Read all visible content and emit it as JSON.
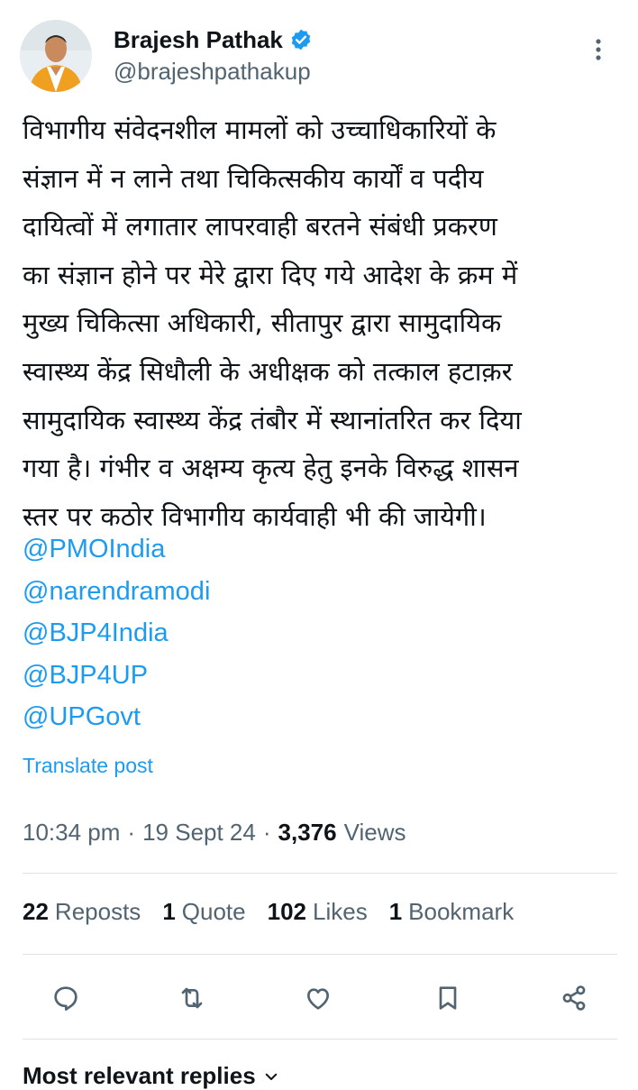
{
  "author": {
    "name": "Brajesh Pathak",
    "handle": "@brajeshpathakup",
    "verified_color": "#1d9bf0",
    "avatar_icon": "person-avatar"
  },
  "tweet": {
    "text": "विभागीय संवेदनशील मामलों को उच्चाधिकारियों के\nसंज्ञान में न लाने तथा चिकित्सकीय कार्यों व पदीय\nदायित्वों में लगातार लापरवाही बरतने संबंधी प्रकरण\nका संज्ञान होने पर मेरे द्वारा दिए गये आदेश के क्रम में\nमुख्य चिकित्सा अधिकारी, सीतापुर द्वारा सामुदायिक\nस्वास्थ्य केंद्र सिधौली के अधीक्षक को तत्काल हटाक़र\nसामुदायिक स्वास्थ्य केंद्र तंबौर में स्थानांतरित कर दिया\nगया है। गंभीर व अक्षम्य कृत्य हेतु इनके विरुद्ध शासन\nस्तर पर कठोर विभागीय कार्यवाही भी की जायेगी।",
    "mentions": [
      "@PMOIndia",
      "@narendramodi",
      "@BJP4India",
      "@BJP4UP",
      "@UPGovt"
    ],
    "translate_label": "Translate post",
    "time": "10:34 pm",
    "date": "19 Sept 24",
    "views_count": "3,376",
    "views_label": "Views"
  },
  "stats": {
    "reposts_count": "22",
    "reposts_label": "Reposts",
    "quotes_count": "1",
    "quotes_label": "Quote",
    "likes_count": "102",
    "likes_label": "Likes",
    "bookmarks_count": "1",
    "bookmarks_label": "Bookmark"
  },
  "actions": [
    "reply-icon",
    "repost-icon",
    "like-icon",
    "bookmark-icon",
    "share-icon"
  ],
  "replies": {
    "header_label": "Most relevant replies"
  },
  "colors": {
    "link": "#1d9bf0",
    "secondary_text": "#536471",
    "primary_text": "#0f1419"
  }
}
